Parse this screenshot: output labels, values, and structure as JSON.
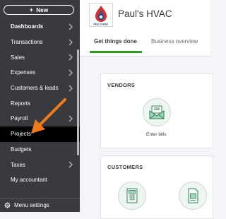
{
  "sidebar": {
    "new_label": "New",
    "items": [
      {
        "label": "Dashboards",
        "chevron": true,
        "bold": true
      },
      {
        "label": "Transactions",
        "chevron": true
      },
      {
        "label": "Sales",
        "chevron": true
      },
      {
        "label": "Expenses",
        "chevron": true
      },
      {
        "label": "Customers & leads",
        "chevron": true
      },
      {
        "label": "Reports",
        "chevron": false
      },
      {
        "label": "Payroll",
        "chevron": true
      },
      {
        "label": "Projects",
        "chevron": false,
        "active": true
      },
      {
        "label": "Budgets",
        "chevron": false
      },
      {
        "label": "Taxes",
        "chevron": true
      },
      {
        "label": "My accountant",
        "chevron": false
      }
    ],
    "menu_settings_label": "Menu settings"
  },
  "header": {
    "company_name": "Paul's HVAC",
    "logo_text": "PAUL'S HVAC",
    "tabs": [
      {
        "label": "Get things done",
        "active": true
      },
      {
        "label": "Business overview",
        "active": false
      }
    ]
  },
  "main": {
    "vendors": {
      "title": "VENDORS",
      "action": "Enter bills"
    },
    "customers": {
      "title": "CUSTOMERS"
    }
  },
  "colors": {
    "sidebar_bg": "#393a3d",
    "active_item_bg": "#000000",
    "accent_green": "#2ca01c",
    "annotation_arrow": "#f07a1a"
  }
}
